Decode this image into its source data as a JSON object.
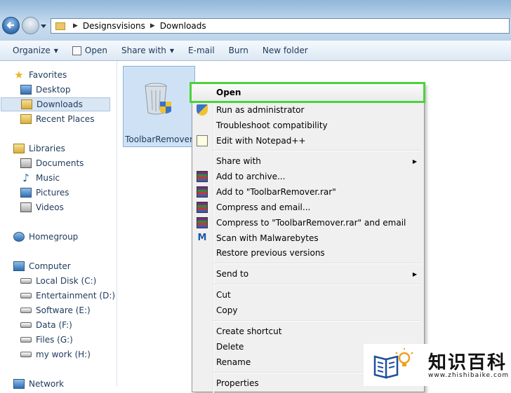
{
  "address": {
    "crumbs": [
      "Designsvisions",
      "Downloads"
    ]
  },
  "toolbar": {
    "organize": "Organize",
    "open": "Open",
    "share_with": "Share with",
    "email": "E-mail",
    "burn": "Burn",
    "new_folder": "New folder"
  },
  "nav": {
    "favorites": "Favorites",
    "desktop": "Desktop",
    "downloads": "Downloads",
    "recent": "Recent Places",
    "libraries": "Libraries",
    "documents": "Documents",
    "music": "Music",
    "pictures": "Pictures",
    "videos": "Videos",
    "homegroup": "Homegroup",
    "computer": "Computer",
    "drives": [
      "Local Disk (C:)",
      "Entertainment (D:)",
      "Software (E:)",
      "Data (F:)",
      "Files (G:)",
      "my work (H:)"
    ],
    "network": "Network"
  },
  "file": {
    "name": "ToolbarRemover"
  },
  "menu": {
    "open": "Open",
    "run_admin": "Run as administrator",
    "troubleshoot": "Troubleshoot compatibility",
    "notepad": "Edit with Notepad++",
    "share_with": "Share with",
    "add_archive": "Add to archive...",
    "add_rar": "Add to \"ToolbarRemover.rar\"",
    "compress_email": "Compress and email...",
    "compress_rar_email": "Compress to \"ToolbarRemover.rar\" and email",
    "malwarebytes": "Scan with Malwarebytes",
    "restore": "Restore previous versions",
    "send_to": "Send to",
    "cut": "Cut",
    "copy": "Copy",
    "create_shortcut": "Create shortcut",
    "delete": "Delete",
    "rename": "Rename",
    "properties": "Properties"
  },
  "watermark": {
    "text": "知识百科",
    "url": "www.zhishibaike.com"
  },
  "colors": {
    "highlight_border": "#4bd33b",
    "selection": "#cfe2f5"
  }
}
